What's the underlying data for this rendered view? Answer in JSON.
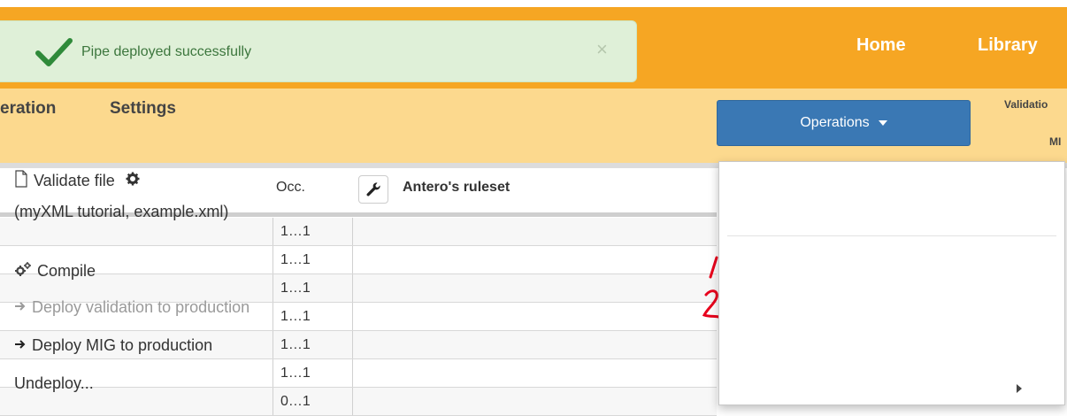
{
  "toast": {
    "message": "Pipe deployed successfully",
    "close_symbol": "×",
    "icon": "check-icon",
    "color": "#3c763d"
  },
  "nav": {
    "home": "Home",
    "library": "Library"
  },
  "subnav": {
    "tab_partial": "eration",
    "settings": "Settings"
  },
  "operations": {
    "label": "Operations"
  },
  "side_labels": {
    "validation": "Validatio",
    "mig": "MI"
  },
  "table": {
    "occ_header": "Occ.",
    "ruleset_header": "Antero's ruleset",
    "rows": [
      "1…1",
      "1…1",
      "1…1",
      "1…1",
      "1…1",
      "1…1",
      "0…1"
    ]
  },
  "menu": {
    "validate_file": "Validate file",
    "validate_sub": "(myXML tutorial, example.xml)",
    "compile": "Compile",
    "deploy_validation": "Deploy validation to production",
    "deploy_mig": "Deploy MIG to production",
    "undeploy": "Undeploy..."
  },
  "annotations": {
    "mark_1": "1",
    "mark_2": "2",
    "color": "#e8001c"
  },
  "colors": {
    "topbar": "#f6a623",
    "subbar": "#fcd98e",
    "button": "#3a78b4",
    "toast_bg": "#dff0d8"
  }
}
